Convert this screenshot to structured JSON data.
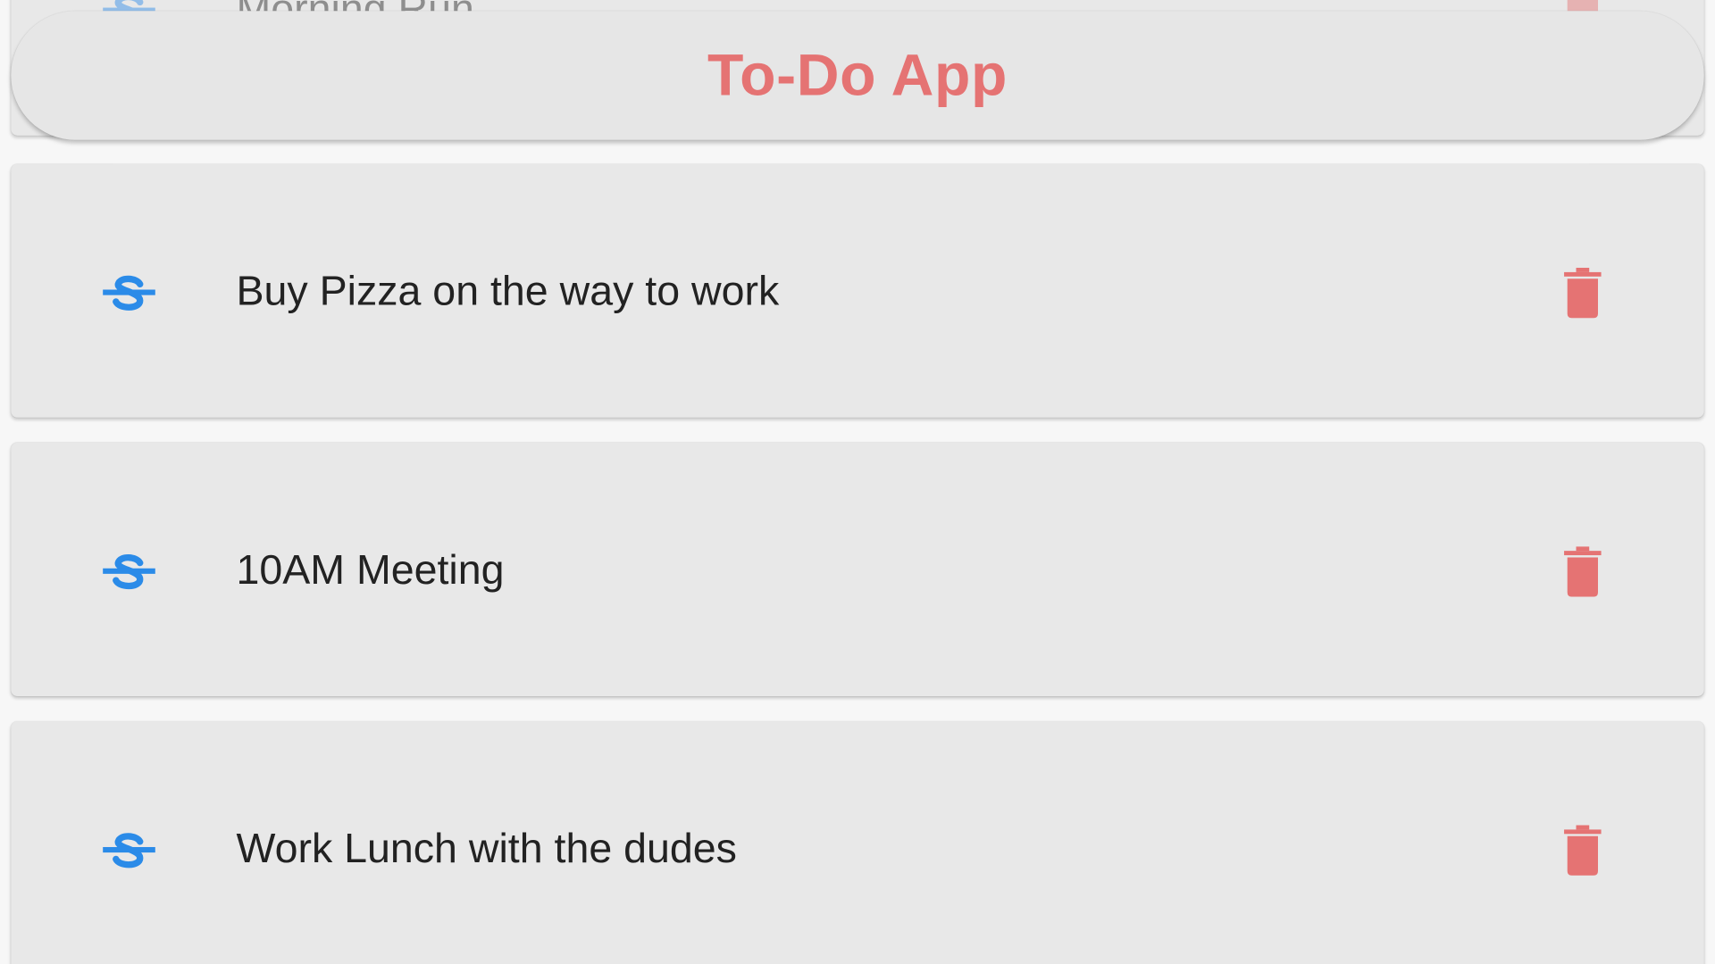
{
  "app_bar": {
    "title": "To-Do App"
  },
  "colors": {
    "accent_title": "#e57373",
    "strike_icon": "#2b8be8",
    "trash_icon": "#e57373",
    "card_bg": "#e8e8e8",
    "text": "#222222"
  },
  "todos": [
    {
      "label": "Morning Run",
      "strike_icon": "strikethrough-icon",
      "delete_icon": "trash-icon"
    },
    {
      "label": "Buy Pizza on the way to work",
      "strike_icon": "strikethrough-icon",
      "delete_icon": "trash-icon"
    },
    {
      "label": "10AM Meeting",
      "strike_icon": "strikethrough-icon",
      "delete_icon": "trash-icon"
    },
    {
      "label": "Work Lunch with the dudes",
      "strike_icon": "strikethrough-icon",
      "delete_icon": "trash-icon"
    }
  ]
}
